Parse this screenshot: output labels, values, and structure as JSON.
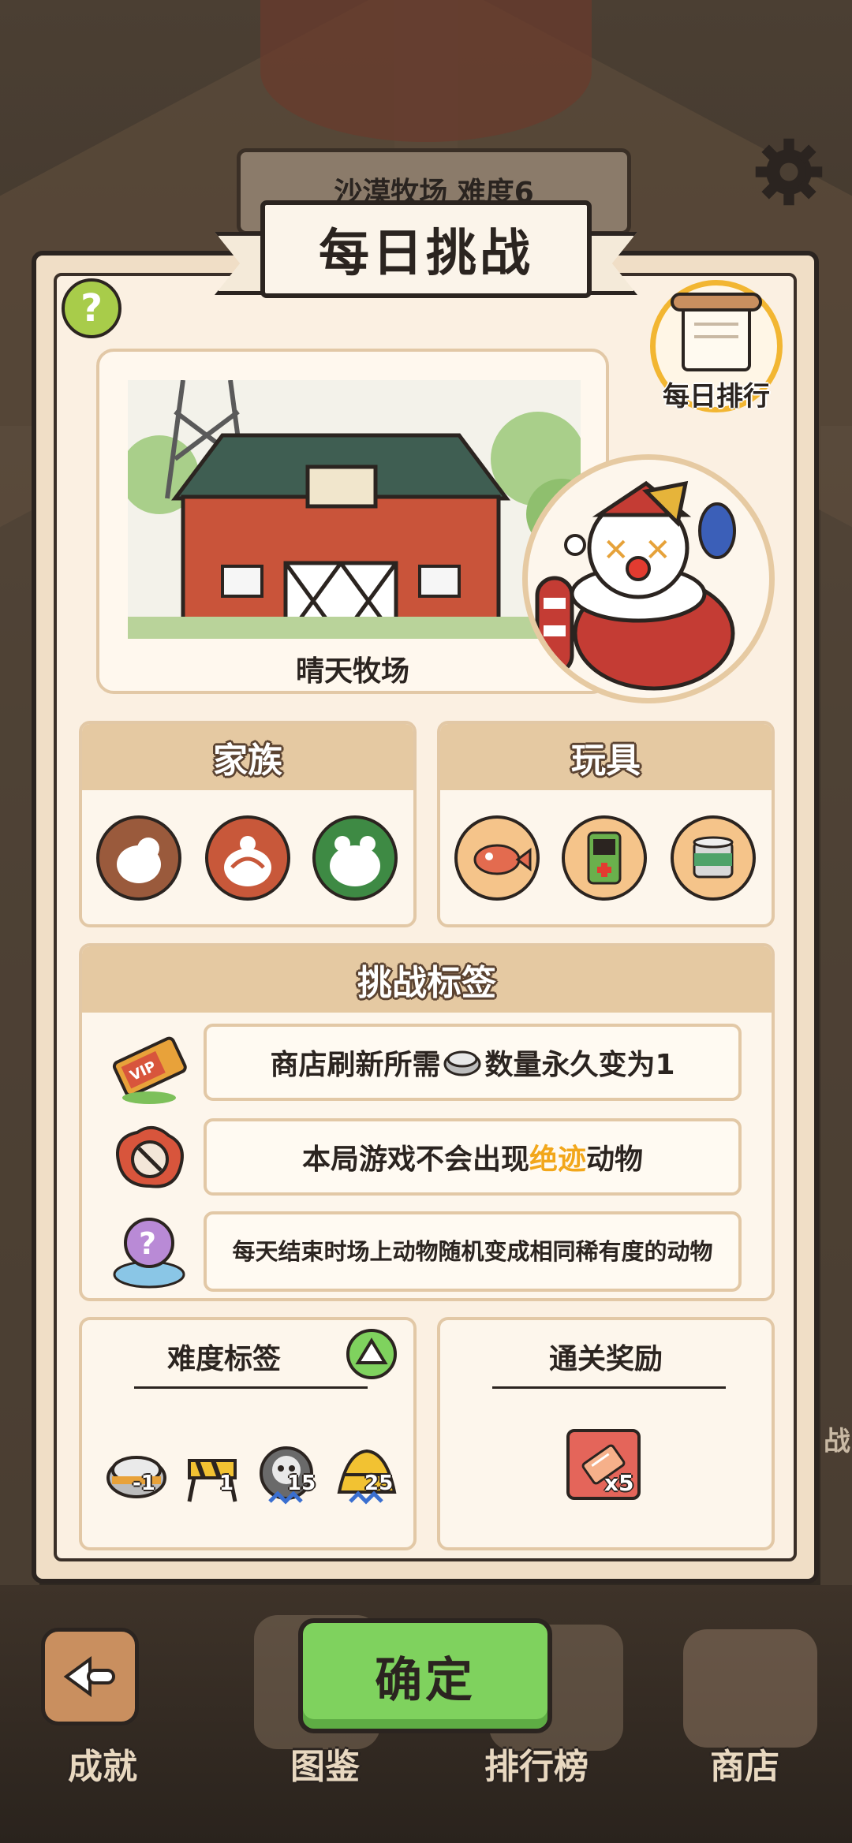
{
  "background": {
    "sign_text": "沙漠牧场 难度6",
    "side_text": "战"
  },
  "dialog": {
    "title": "每日挑战",
    "help_label": "?",
    "rank_label": "每日排行",
    "map_name": "晴天牧场"
  },
  "family": {
    "title": "家族",
    "icons": [
      {
        "name": "family-bird-icon",
        "color": "#9a5a3c"
      },
      {
        "name": "family-monkey-icon",
        "color": "#c8583a"
      },
      {
        "name": "family-frog-icon",
        "color": "#3e8a44"
      }
    ]
  },
  "toys": {
    "title": "玩具",
    "icons": [
      "toy-fish-icon",
      "toy-gameboy-icon",
      "toy-can-icon"
    ]
  },
  "challenge_tags": {
    "title": "挑战标签",
    "rows": [
      {
        "icon": "vip-ticket-icon",
        "text_before": "商店刷新所需",
        "text_after": "数量永久变为1"
      },
      {
        "icon": "no-extinct-icon",
        "text_before": "本局游戏不会出现",
        "highlight": "绝迹",
        "text_after": "动物"
      },
      {
        "icon": "random-animal-icon",
        "text": "每天结束时场上动物随机变成相同稀有度的动物"
      }
    ]
  },
  "difficulty": {
    "title": "难度标签",
    "items": [
      {
        "icon": "can-icon",
        "value": "-1"
      },
      {
        "icon": "barrier-icon",
        "value": "1"
      },
      {
        "icon": "ghost-coin-icon",
        "value": "15"
      },
      {
        "icon": "gold-pile-icon",
        "value": "25"
      }
    ]
  },
  "reward": {
    "title": "通关奖励",
    "item_icon": "ticket-reward-icon",
    "count": "x5"
  },
  "bottom_nav": {
    "achievements": "成就",
    "catalog": "图鉴",
    "leaderboard": "排行榜",
    "shop": "商店",
    "confirm": "确定"
  },
  "colors": {
    "accent_green": "#7fd25e",
    "highlight_orange": "#f2a71b",
    "panel_bg": "#fbf0e2",
    "section_head": "#e5c9a2"
  }
}
